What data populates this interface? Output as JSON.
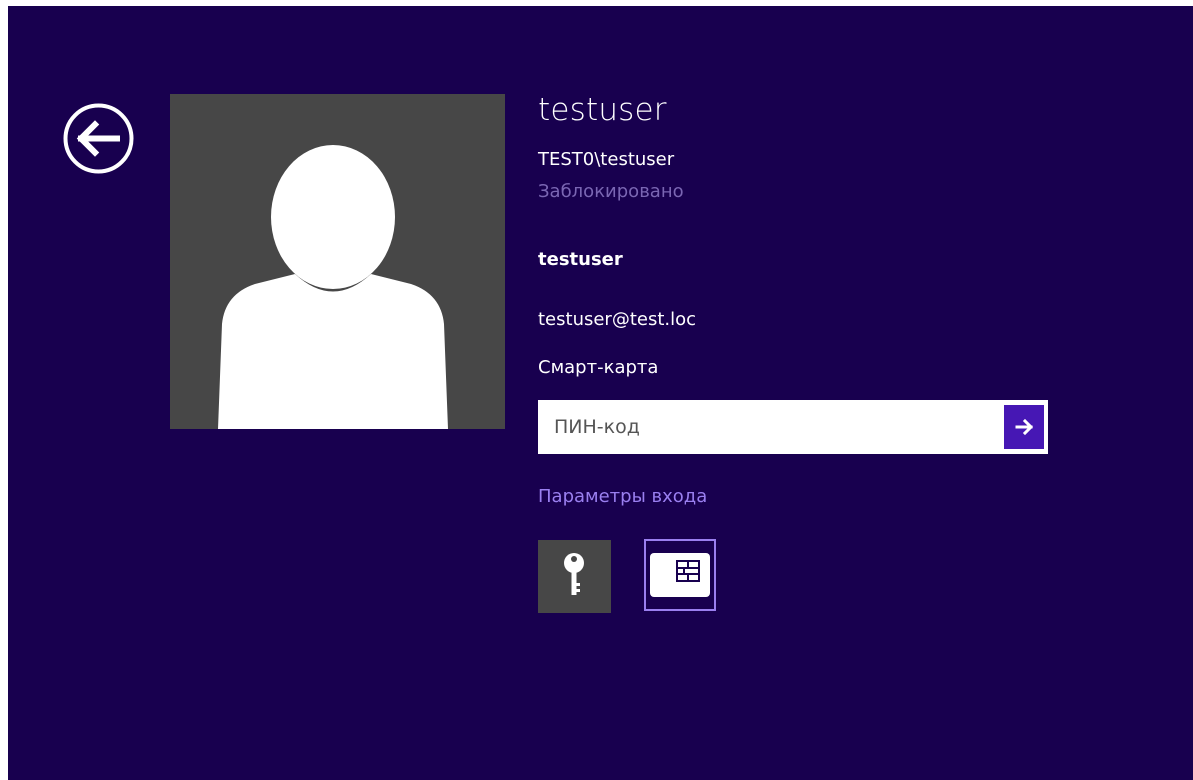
{
  "user": {
    "display_name": "testuser",
    "account": "TEST0\\testuser",
    "status": "Заблокировано"
  },
  "certificate": {
    "name": "testuser",
    "email": "testuser@test.loc"
  },
  "credential": {
    "type_label": "Смарт-карта",
    "pin_placeholder": "ПИН-код",
    "pin_value": ""
  },
  "sign_in_options": {
    "label": "Параметры входа",
    "items": [
      {
        "icon": "key-icon",
        "selected": false
      },
      {
        "icon": "smartcard-icon",
        "selected": true
      }
    ]
  },
  "icons": {
    "back": "back-arrow-icon",
    "submit": "right-arrow-icon"
  },
  "colors": {
    "background": "#18004f",
    "accent": "#4617b4",
    "link": "#9a7ff0",
    "status": "#7a66b3",
    "tile": "#474747"
  }
}
